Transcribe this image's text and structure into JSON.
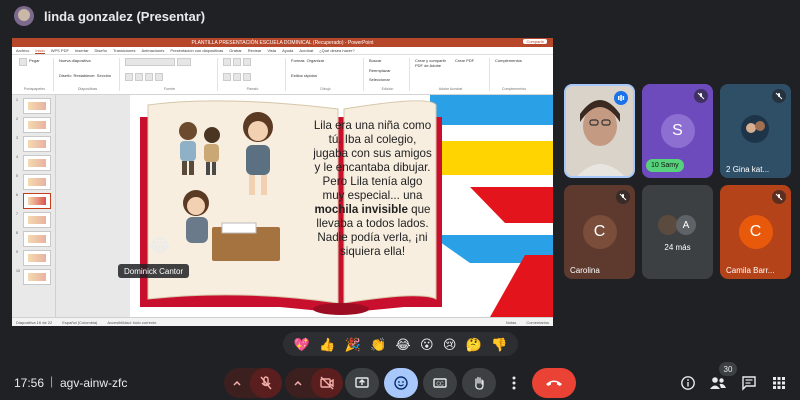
{
  "topbar": {
    "presenter": "linda gonzalez (Presentar)"
  },
  "ppt": {
    "title": "PLANTILLA PRESENTACIÓN ESCUELA DOMINICAL (Recuperado) - PowerPoint",
    "share": "Compartir",
    "tabs": [
      "Archivo",
      "Inicio",
      "WPS PDF",
      "Insertar",
      "Diseño",
      "Transiciones",
      "Animaciones",
      "Presentación con diapositivas",
      "Grabar",
      "Revisar",
      "Vista",
      "Ayuda",
      "Acrobat",
      "¿Qué desea hacer?"
    ],
    "ribbon": {
      "paste": "Pegar",
      "clipboard": "Portapapeles",
      "new_slide": "Nueva diapositiva",
      "layout": "Diseño",
      "reset": "Restablecer",
      "section": "Sección",
      "slides": "Diapositivas",
      "font": "Fuente",
      "paragraph": "Párrafo",
      "shapes": "Formas",
      "arrange": "Organizar",
      "quick_styles": "Estilos rápidos",
      "drawing": "Dibujo",
      "find": "Buscar",
      "replace": "Reemplazar",
      "select": "Seleccionar",
      "editing": "Edición",
      "create_share_pdf": "Crear y compartir PDF de Adobe",
      "adobe": "Adobe Acrobat",
      "create_pdf": "Crear PDF",
      "addins": "Complementos",
      "addins_group": "Complementos"
    },
    "status": {
      "slide": "Diapositiva 16 de 22",
      "lang": "Español (Colombia)",
      "access": "Accesibilidad: todo correcto",
      "notes": "Notas",
      "comments": "Comentarios"
    },
    "thumbs": [
      "1",
      "2",
      "3",
      "4",
      "5",
      "6",
      "7",
      "8",
      "9",
      "10",
      "11",
      "12",
      "13",
      "14"
    ]
  },
  "slide": {
    "text_before": "Lila era una niña como tú. Iba al colegio, jugaba con sus amigos y le encantaba dibujar. Pero Lila tenía algo muy especial... una ",
    "text_bold": "mochila invisible",
    "text_after": " que llevaba a todos lados. Nadie podía verla, ¡ni siquiera ella!"
  },
  "overlay": {
    "speaker_chip": "Dominick Cantor",
    "speaker_emoji": "😂"
  },
  "participants": [
    {
      "name": "",
      "letter": "",
      "color": "#c9c2b8",
      "muted": false,
      "speaking": true
    },
    {
      "name": "Samy",
      "letter": "S",
      "color": "#7e57c2",
      "muted": true,
      "reactions": "10"
    },
    {
      "name": "Gina kat...",
      "letter": "",
      "color": "#3a5f7a",
      "muted": true,
      "reactions": "2"
    },
    {
      "name": "Carolina",
      "letter": "C",
      "color": "#8a5a44",
      "muted": true
    },
    {
      "name": "24 más",
      "letter": "A",
      "color": "#5f6368",
      "muted": false
    },
    {
      "name": "Camila Barr...",
      "letter": "C",
      "color": "#e8590c",
      "muted": true
    }
  ],
  "reactions": [
    "💖",
    "👍",
    "🎉",
    "👏",
    "😂",
    "😮",
    "😢",
    "🤔",
    "👎"
  ],
  "bottom": {
    "time": "17:56",
    "separator": "|",
    "meeting_code": "agv-ainw-zfc",
    "people_count": "30"
  },
  "colors": {
    "bg": "#202124",
    "end_call": "#ea4335",
    "accent_blue": "#a8c7fa",
    "ppt_red": "#b7472a"
  }
}
